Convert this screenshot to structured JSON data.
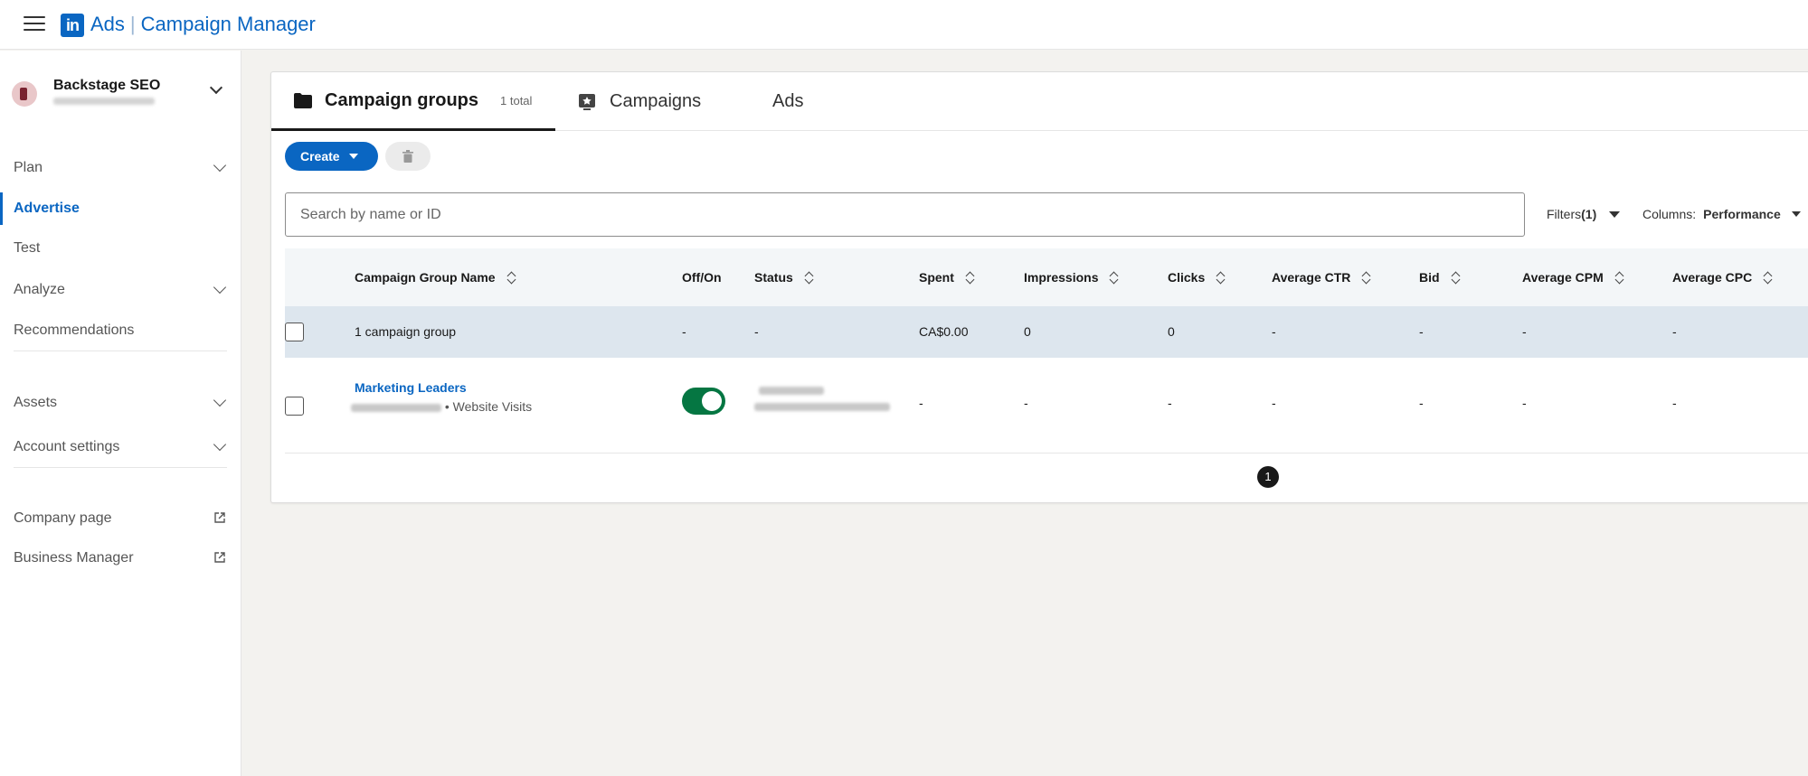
{
  "app": {
    "brand": "Ads",
    "product": "Campaign Manager"
  },
  "sidebar": {
    "account_name": "Backstage SEO",
    "items": [
      {
        "label": "Plan"
      },
      {
        "label": "Advertise"
      },
      {
        "label": "Test"
      },
      {
        "label": "Analyze"
      },
      {
        "label": "Recommendations"
      },
      {
        "label": "Assets"
      },
      {
        "label": "Account settings"
      },
      {
        "label": "Company page"
      },
      {
        "label": "Business Manager"
      }
    ]
  },
  "tabs": [
    {
      "label": "Campaign groups",
      "count": "1 total"
    },
    {
      "label": "Campaigns"
    },
    {
      "label": "Ads"
    }
  ],
  "toolbar": {
    "create_label": "Create",
    "search_placeholder": "Search by name or ID",
    "filters_label": "Filters",
    "filters_count": "(1)",
    "columns_label": "Columns:",
    "columns_value": "Performance"
  },
  "table": {
    "headers": [
      "Campaign Group Name",
      "Off/On",
      "Status",
      "Spent",
      "Impressions",
      "Clicks",
      "Average CTR",
      "Bid",
      "Average CPM",
      "Average CPC"
    ],
    "summary": {
      "name": "1 campaign group",
      "off_on": "-",
      "status": "-",
      "spent": "CA$0.00",
      "impressions": "0",
      "clicks": "0",
      "ctr": "-",
      "bid": "-",
      "cpm": "-",
      "cpc": "-"
    },
    "rows": [
      {
        "name": "Marketing Leaders",
        "objective": "• Website Visits",
        "toggle_on": true,
        "spent": "-",
        "impressions": "-",
        "clicks": "-",
        "ctr": "-",
        "bid": "-",
        "cpm": "-",
        "cpc": "-"
      }
    ]
  },
  "pagination": {
    "current": "1"
  },
  "colors": {
    "brand": "#0a66c2",
    "toggle_on": "#057642",
    "summary_row": "#dde6ee"
  }
}
